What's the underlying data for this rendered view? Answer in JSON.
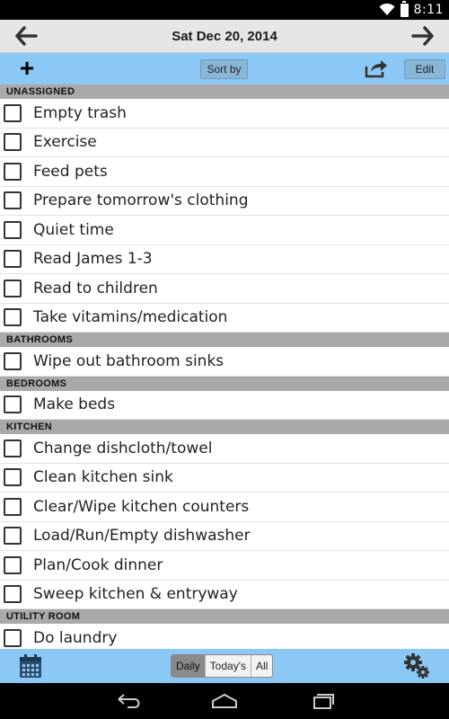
{
  "status_bar": {
    "time": "8:11",
    "icons": [
      "wifi-icon",
      "battery-icon"
    ]
  },
  "header": {
    "date_title": "Sat Dec 20, 2014",
    "prev_icon": "arrow-left-icon",
    "next_icon": "arrow-right-icon"
  },
  "toolbar": {
    "add_icon": "plus-icon",
    "add_glyph": "+",
    "sort_label": "Sort by",
    "share_icon": "share-icon",
    "edit_label": "Edit",
    "accent_color": "#8cc8f5"
  },
  "sections": [
    {
      "name": "UNASSIGNED",
      "items": [
        "Empty trash",
        "Exercise",
        "Feed pets",
        "Prepare tomorrow's clothing",
        "Quiet time",
        "Read James 1-3",
        "Read to children",
        "Take vitamins/medication"
      ]
    },
    {
      "name": "BATHROOMS",
      "items": [
        "Wipe out bathroom sinks"
      ]
    },
    {
      "name": "BEDROOMS",
      "items": [
        "Make beds"
      ]
    },
    {
      "name": "KITCHEN",
      "items": [
        "Change dishcloth/towel",
        "Clean kitchen sink",
        "Clear/Wipe kitchen counters",
        "Load/Run/Empty dishwasher",
        "Plan/Cook dinner",
        "Sweep kitchen & entryway"
      ]
    },
    {
      "name": "UTILITY ROOM",
      "items": [
        "Do laundry"
      ]
    }
  ],
  "bottom_bar": {
    "calendar_icon": "calendar-icon",
    "filters": [
      "Daily",
      "Today's",
      "All"
    ],
    "active_filter": "Daily",
    "settings_icon": "gear-icon"
  },
  "nav_bar": {
    "icons": [
      "back-icon",
      "home-icon",
      "recent-apps-icon"
    ]
  }
}
